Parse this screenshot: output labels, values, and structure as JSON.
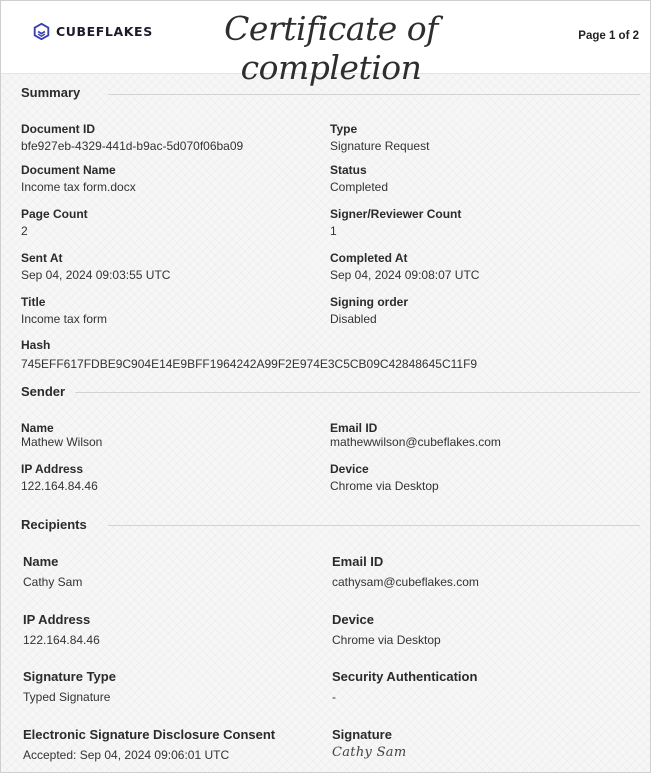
{
  "header": {
    "brand": "CUBEFLAKES",
    "title": "Certificate of completion",
    "page": "Page 1 of 2"
  },
  "summary": {
    "heading": "Summary",
    "document_id": {
      "label": "Document ID",
      "value": "bfe927eb-4329-441d-b9ac-5d070f06ba09"
    },
    "type": {
      "label": "Type",
      "value": "Signature Request"
    },
    "document_name": {
      "label": "Document Name",
      "value": "Income tax form.docx"
    },
    "status": {
      "label": "Status",
      "value": "Completed"
    },
    "page_count": {
      "label": "Page Count",
      "value": "2"
    },
    "signer_count": {
      "label": "Signer/Reviewer Count",
      "value": "1"
    },
    "sent_at": {
      "label": "Sent At",
      "value": "Sep 04, 2024 09:03:55 UTC"
    },
    "completed_at": {
      "label": "Completed At",
      "value": "Sep 04, 2024 09:08:07 UTC"
    },
    "title": {
      "label": "Title",
      "value": "Income tax form"
    },
    "signing_order": {
      "label": "Signing order",
      "value": "Disabled"
    },
    "hash": {
      "label": "Hash",
      "value": "745EFF617FDBE9C904E14E9BFF1964242A99F2E974E3C5CB09C42848645C11F9"
    }
  },
  "sender": {
    "heading": "Sender",
    "name": {
      "label": "Name",
      "value": "Mathew Wilson"
    },
    "email": {
      "label": "Email ID",
      "value": "mathewwilson@cubeflakes.com"
    },
    "ip": {
      "label": "IP Address",
      "value": "122.164.84.46"
    },
    "device": {
      "label": "Device",
      "value": "Chrome via Desktop"
    }
  },
  "recipients": {
    "heading": "Recipients",
    "name": {
      "label": "Name",
      "value": "Cathy Sam"
    },
    "email": {
      "label": "Email ID",
      "value": "cathysam@cubeflakes.com"
    },
    "ip": {
      "label": "IP Address",
      "value": "122.164.84.46"
    },
    "device": {
      "label": "Device",
      "value": "Chrome via Desktop"
    },
    "signature_type": {
      "label": "Signature Type",
      "value": "Typed Signature"
    },
    "security": {
      "label": "Security Authentication",
      "value": "-"
    },
    "consent": {
      "label": "Electronic Signature Disclosure Consent",
      "value": "Accepted: Sep 04, 2024 09:06:01 UTC"
    },
    "signature": {
      "label": "Signature",
      "value": "Cathy Sam"
    }
  },
  "colors": {
    "brand": "#3b3fb0",
    "rule": "#d3d3d3"
  },
  "icons": {
    "logo": "cube-logo-icon"
  }
}
